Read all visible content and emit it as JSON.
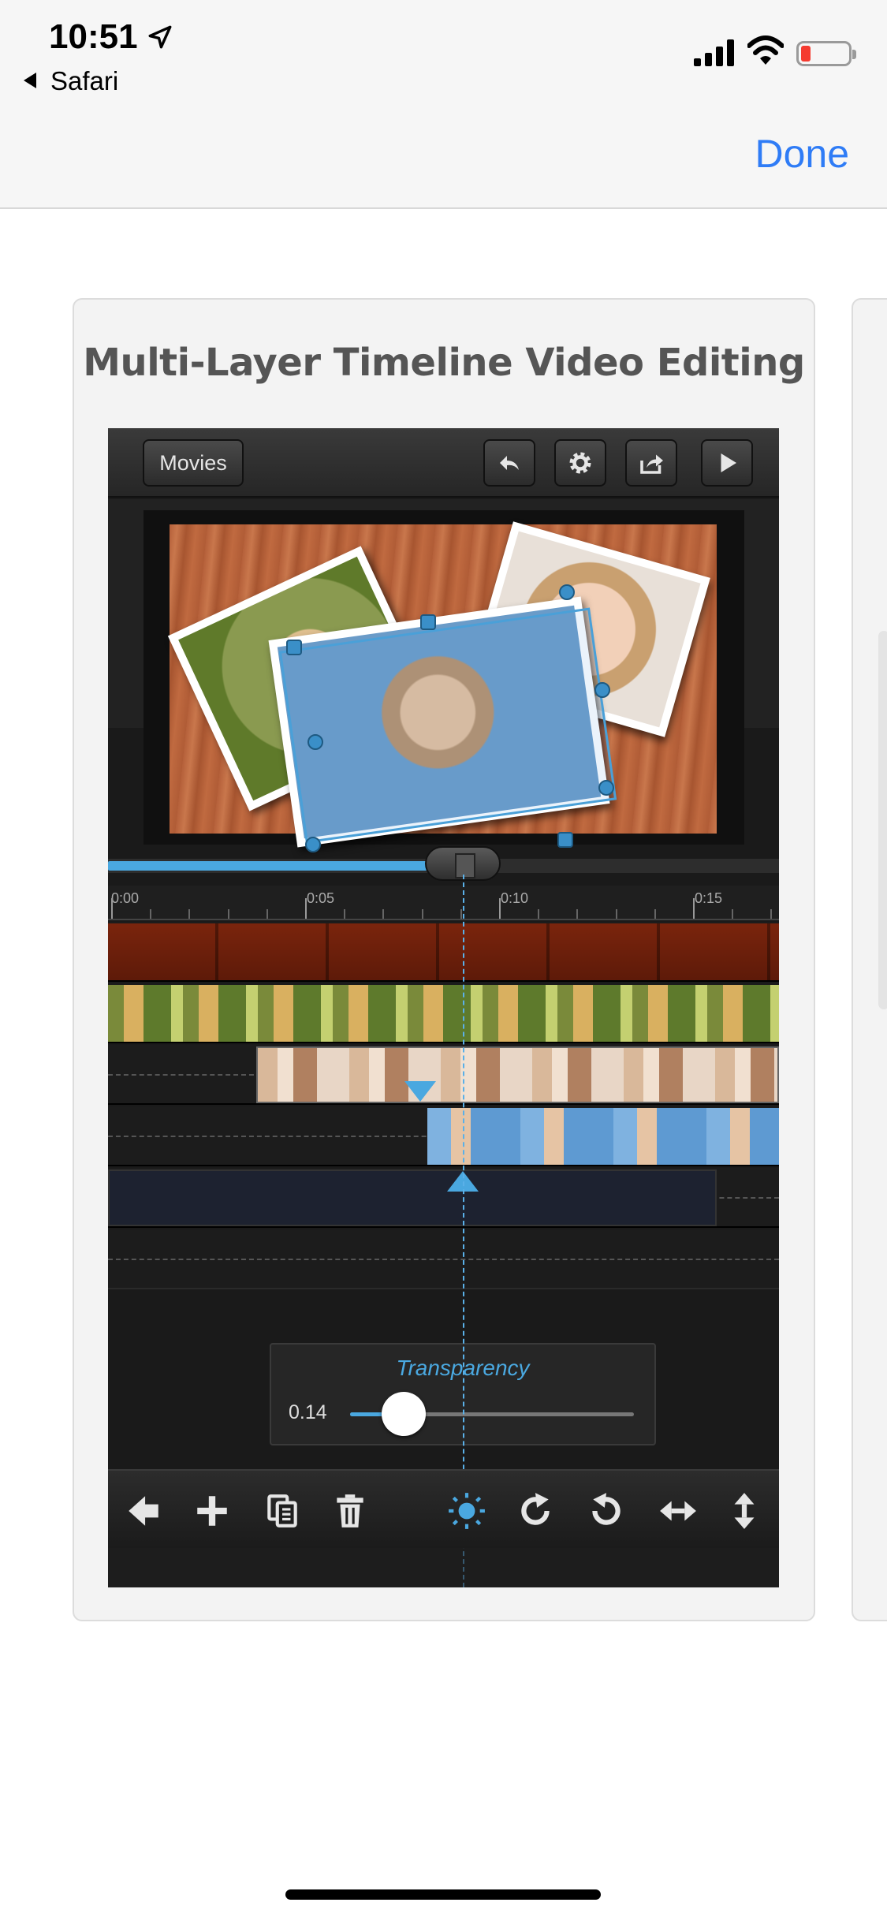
{
  "status_bar": {
    "time": "10:51",
    "back_label": "Safari",
    "battery_color": "#f53b30"
  },
  "nav": {
    "done_label": "Done",
    "done_color": "#2f7cf6"
  },
  "card": {
    "title": "Multi-Layer Timeline Video Editing"
  },
  "app": {
    "header": {
      "movies_label": "Movies",
      "buttons": [
        "undo-icon",
        "gear-icon",
        "share-icon",
        "play-icon"
      ]
    },
    "scrubber": {
      "progress": 0.5
    },
    "ruler": {
      "labels": [
        "0:00",
        "0:05",
        "0:10",
        "0:15"
      ]
    },
    "tracks": [
      {
        "name": "wood-background",
        "type": "video"
      },
      {
        "name": "teddy-bear-clip",
        "type": "video"
      },
      {
        "name": "smiling-girl-clip",
        "type": "video"
      },
      {
        "name": "seashell-girl-clip",
        "type": "video"
      },
      {
        "name": "audio-track",
        "type": "audio"
      },
      {
        "name": "empty-track",
        "type": "empty"
      }
    ],
    "transparency": {
      "title": "Transparency",
      "value": "0.14",
      "level": 0.14
    },
    "toolbar": [
      "back-arrow-icon",
      "add-icon",
      "copy-icon",
      "trash-icon",
      "brightness-icon",
      "rotate-cw-icon",
      "rotate-ccw-icon",
      "flip-horizontal-icon",
      "flip-vertical-icon"
    ]
  }
}
